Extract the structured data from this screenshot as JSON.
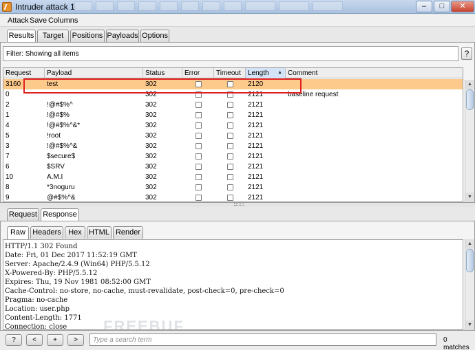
{
  "window": {
    "title": "Intruder attack 1"
  },
  "menu": [
    "Attack",
    "Save",
    "Columns"
  ],
  "top_tabs": [
    "Results",
    "Target",
    "Positions",
    "Payloads",
    "Options"
  ],
  "filter": {
    "text": "Filter: Showing all items",
    "help": "?"
  },
  "table": {
    "columns": [
      "Request",
      "Payload",
      "Status",
      "Error",
      "Timeout",
      "Length",
      "Comment"
    ],
    "sort_arrow": "▲",
    "rows": [
      {
        "request": "3160",
        "payload": "test",
        "status": "302",
        "length": "2120",
        "comment": ""
      },
      {
        "request": "0",
        "payload": "",
        "status": "302",
        "length": "2121",
        "comment": "baseline request"
      },
      {
        "request": "2",
        "payload": "!@#$%^",
        "status": "302",
        "length": "2121",
        "comment": ""
      },
      {
        "request": "1",
        "payload": "!@#$%",
        "status": "302",
        "length": "2121",
        "comment": ""
      },
      {
        "request": "4",
        "payload": "!@#$%^&*",
        "status": "302",
        "length": "2121",
        "comment": ""
      },
      {
        "request": "5",
        "payload": "!root",
        "status": "302",
        "length": "2121",
        "comment": ""
      },
      {
        "request": "3",
        "payload": "!@#$%^&",
        "status": "302",
        "length": "2121",
        "comment": ""
      },
      {
        "request": "7",
        "payload": "$secure$",
        "status": "302",
        "length": "2121",
        "comment": ""
      },
      {
        "request": "6",
        "payload": "$SRV",
        "status": "302",
        "length": "2121",
        "comment": ""
      },
      {
        "request": "10",
        "payload": "A.M.I",
        "status": "302",
        "length": "2121",
        "comment": ""
      },
      {
        "request": "8",
        "payload": "*3noguru",
        "status": "302",
        "length": "2121",
        "comment": ""
      },
      {
        "request": "9",
        "payload": "@#$%^&",
        "status": "302",
        "length": "2121",
        "comment": ""
      }
    ]
  },
  "detail_tabs": [
    "Request",
    "Response"
  ],
  "view_tabs": [
    "Raw",
    "Headers",
    "Hex",
    "HTML",
    "Render"
  ],
  "response_lines": [
    "HTTP/1.1 302 Found",
    "Date: Fri, 01 Dec 2017 11:52:19 GMT",
    "Server: Apache/2.4.9 (Win64) PHP/5.5.12",
    "X-Powered-By: PHP/5.5.12",
    "Expires: Thu, 19 Nov 1981 08:52:00 GMT",
    "Cache-Control: no-store, no-cache, must-revalidate, post-check=0, pre-check=0",
    "Pragma: no-cache",
    "Location: user.php",
    "Content-Length: 1771",
    "Connection: close"
  ],
  "search": {
    "buttons": [
      "?",
      "<",
      "+",
      ">"
    ],
    "placeholder": "Type a search term",
    "matches": "0 matches"
  },
  "watermark": "FREEBUF",
  "colors": {
    "selected_row": "#fdca8b",
    "highlight_box": "#e02020",
    "sorted_header": "#d4e4f8"
  }
}
